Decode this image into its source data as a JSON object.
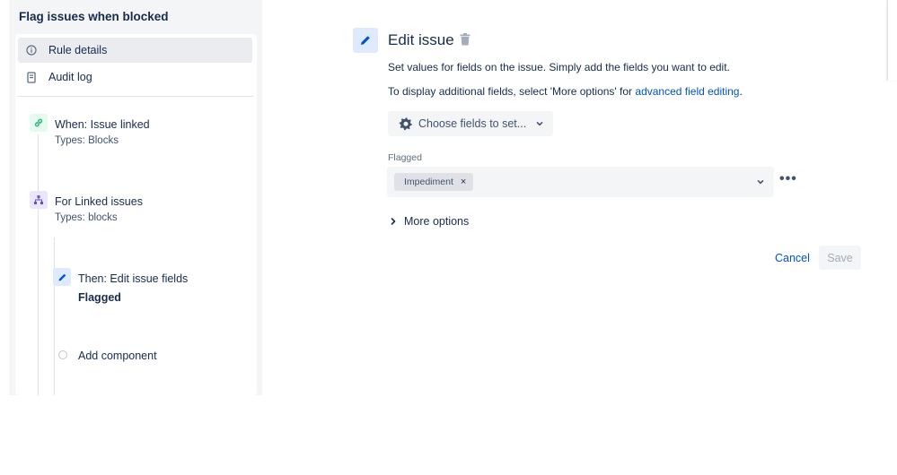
{
  "rule": {
    "title": "Flag issues when blocked"
  },
  "nav": {
    "rule_details": "Rule details",
    "audit_log": "Audit log"
  },
  "flow": {
    "trigger": {
      "title": "When: Issue linked",
      "sub": "Types: Blocks"
    },
    "branch": {
      "title": "For Linked issues",
      "sub": "Types: blocks"
    },
    "action": {
      "title": "Then: Edit issue fields",
      "bold": "Flagged"
    },
    "add_component": "Add component"
  },
  "editor": {
    "title": "Edit issue",
    "desc1": "Set values for fields on the issue. Simply add the fields you want to edit.",
    "desc2_prefix": "To display additional fields, select 'More options' for ",
    "desc2_link": "advanced field editing",
    "desc2_suffix": ".",
    "choose_fields": "Choose fields to set...",
    "field_label": "Flagged",
    "chip": "Impediment",
    "chip_remove": "×",
    "more_dots": "•••",
    "more_options": "More options",
    "cancel": "Cancel",
    "save": "Save"
  },
  "colors": {
    "accent": "#0052cc",
    "trigger_icon": "#36b37e",
    "branch_icon": "#6554c0",
    "action_icon": "#0052cc"
  }
}
